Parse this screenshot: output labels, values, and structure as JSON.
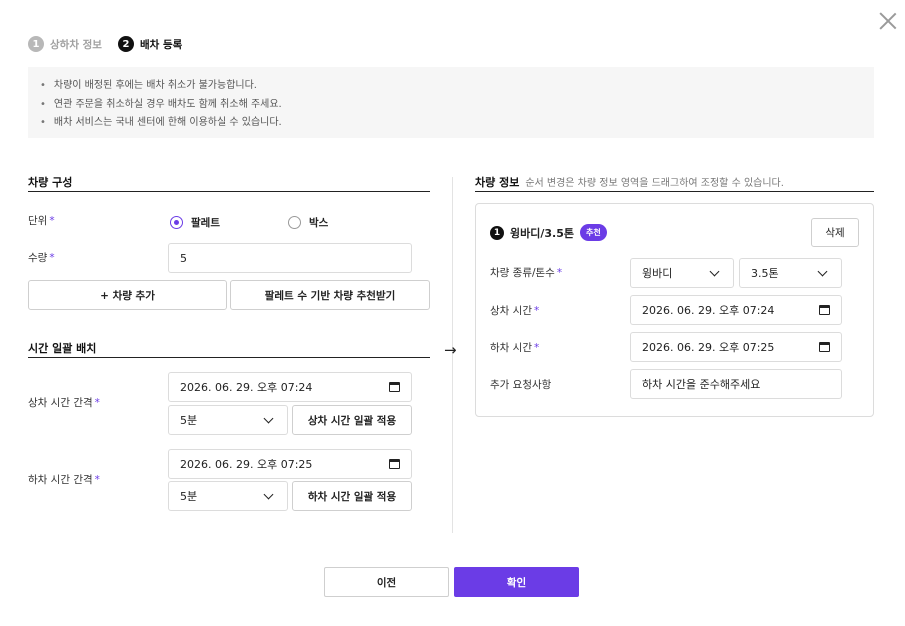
{
  "steps": [
    {
      "num": "1",
      "label": "상하차 정보"
    },
    {
      "num": "2",
      "label": "배차 등록"
    }
  ],
  "notices": [
    "차량이 배정된 후에는 배차 취소가 불가능합니다.",
    "연관 주문을 취소하실 경우 배차도 함께 취소해 주세요.",
    "배차 서비스는 국내 센터에 한해 이용하실 수 있습니다."
  ],
  "vehicle_config": {
    "title": "차량 구성",
    "unit_label": "단위",
    "unit_options": [
      "팔레트",
      "박스"
    ],
    "unit_selected": "팔레트",
    "qty_label": "수량",
    "qty_value": "5",
    "add_vehicle_label": "+ 차량 추가",
    "recommend_label": "팔레트 수 기반 차량 추천받기"
  },
  "batch_time": {
    "title": "시간 일괄 배치",
    "load_label": "상차 시간 간격",
    "load_datetime": "2026. 06. 29. 오후 07:24",
    "load_interval": "5분",
    "load_apply_label": "상차 시간 일괄 적용",
    "unload_label": "하차 시간 간격",
    "unload_datetime": "2026. 06. 29. 오후 07:25",
    "unload_interval": "5분",
    "unload_apply_label": "하차 시간 일괄 적용"
  },
  "vehicle_info": {
    "title": "차량 정보",
    "hint": "순서 변경은 차량 정보 영역을 드래그하여 조정할 수 있습니다.",
    "card": {
      "num": "1",
      "name": "윙바디/3.5톤",
      "badge": "추천",
      "delete_label": "삭제",
      "type_label": "차량 종류/톤수",
      "type_value": "윙바디",
      "ton_value": "3.5톤",
      "load_label": "상차 시간",
      "load_value": "2026. 06. 29. 오후 07:24",
      "unload_label": "하차 시간",
      "unload_value": "2026. 06. 29. 오후 07:25",
      "request_label": "추가 요청사항",
      "request_value": "하차 시간을 준수해주세요"
    }
  },
  "footer": {
    "prev_label": "이전",
    "ok_label": "확인"
  },
  "colors": {
    "accent": "#6b3ce6"
  },
  "icons": {
    "close": "close-icon",
    "arrow": "arrow-right-icon",
    "calendar": "calendar-icon",
    "chevron": "chevron-down-icon"
  }
}
